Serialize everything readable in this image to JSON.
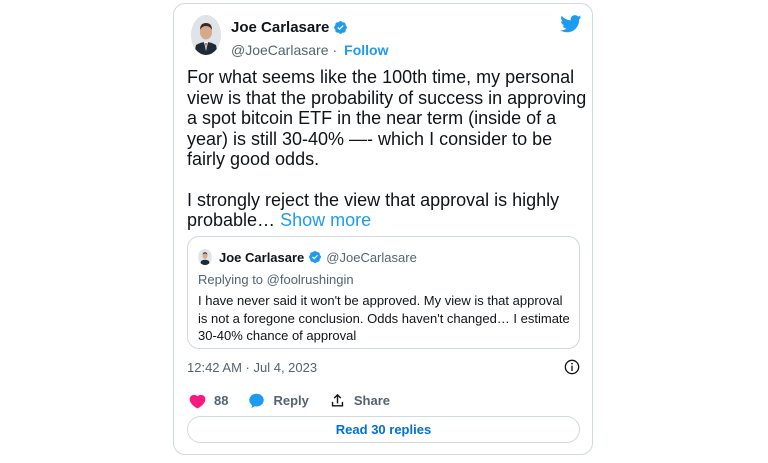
{
  "tweet": {
    "author_name": "Joe Carlasare",
    "author_handle": "@JoeCarlasare",
    "separator": "·",
    "follow_label": "Follow",
    "text_paragraph_1": "For what seems like the 100th time, my personal view is that the probability of success in approving a spot bitcoin ETF in the near term (inside of a year) is still 30-40% —- which I consider to be fairly good odds.",
    "text_paragraph_2": "I strongly reject the view that approval is highly probable…",
    "show_more_label": "Show more",
    "timestamp": "12:42 AM · Jul 4, 2023",
    "likes_count": "88",
    "reply_label": "Reply",
    "share_label": "Share",
    "read_replies_label": "Read 30 replies"
  },
  "quoted_tweet": {
    "author_name": "Joe Carlasare",
    "author_handle": "@JoeCarlasare",
    "replying_to": "Replying to @foolrushingin",
    "text": "I have never said it won't be approved. My view is that approval is not a foregone conclusion. Odds haven't changed… I estimate 30-40% chance of approval"
  },
  "icons": {
    "verified": "verified-badge-icon",
    "brand": "twitter-bird-icon",
    "like": "heart-icon",
    "reply": "speech-bubble-icon",
    "share": "share-upload-icon",
    "info": "info-icon"
  },
  "colors": {
    "accent": "#1d9bf0",
    "like": "#f91880",
    "link_button_text": "#006fd6",
    "secondary_text": "#536471",
    "border": "#cfd9de"
  }
}
